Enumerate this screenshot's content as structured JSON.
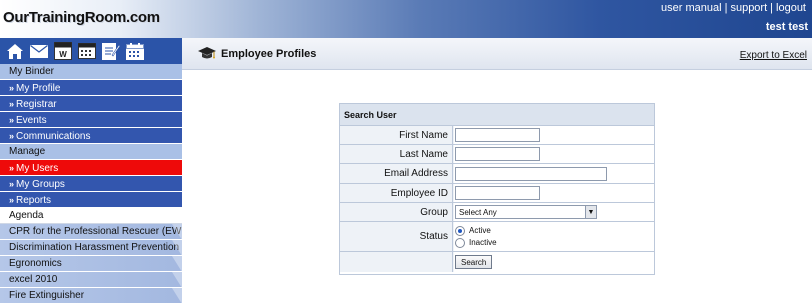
{
  "header": {
    "logo": "OurTrainingRoom.com",
    "links": [
      "user manual",
      "support",
      "logout"
    ],
    "user": "test test"
  },
  "toolbar": {
    "icons": [
      "home-icon",
      "mail-icon",
      "diy-icon",
      "dvd-icon",
      "edit-icon",
      "calendar-icon"
    ]
  },
  "sidebar": {
    "my_binder": "My Binder",
    "binder_items": [
      "My Profile",
      "Registrar",
      "Events",
      "Communications"
    ],
    "manage": "Manage",
    "manage_items": [
      "My Users",
      "My Groups",
      "Reports"
    ],
    "agenda": "Agenda",
    "courses": [
      "CPR for the Professional Rescuer (EWEMS)",
      "Discrimination Harassment Prevention",
      "Egronomics",
      "excel 2010",
      "Fire Extinguisher"
    ]
  },
  "main": {
    "title": "Employee Profiles",
    "export": "Export to Excel"
  },
  "search": {
    "title": "Search User",
    "labels": {
      "first_name": "First Name",
      "last_name": "Last Name",
      "email": "Email Address",
      "employee_id": "Employee ID",
      "group": "Group",
      "status": "Status"
    },
    "values": {
      "first_name": "",
      "last_name": "",
      "email": "",
      "employee_id": ""
    },
    "group_selected": "Select Any",
    "status_options": [
      "Active",
      "Inactive"
    ],
    "status_selected": "Active",
    "button": "Search"
  }
}
